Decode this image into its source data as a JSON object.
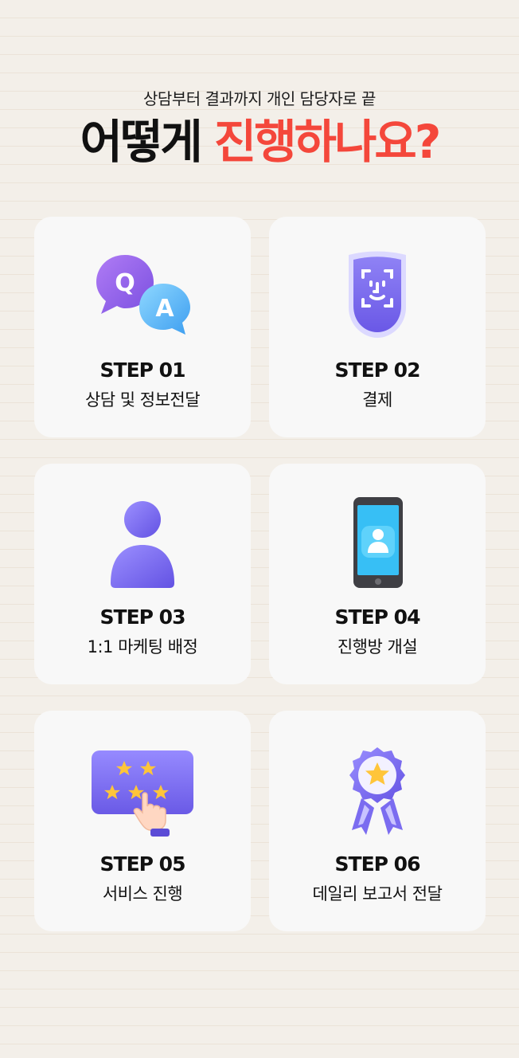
{
  "header": {
    "subtitle": "상담부터 결과까지 개인 담당자로 끝",
    "title_part1": "어떻게",
    "title_part2": "진행하나요?"
  },
  "steps": [
    {
      "step": "STEP 01",
      "desc": "상담 및 정보전달",
      "icon": "qa-bubbles-icon"
    },
    {
      "step": "STEP 02",
      "desc": "결제",
      "icon": "face-id-shield-icon"
    },
    {
      "step": "STEP 03",
      "desc": "1:1 마케팅 배정",
      "icon": "person-icon"
    },
    {
      "step": "STEP 04",
      "desc": "진행방 개설",
      "icon": "smartphone-profile-icon"
    },
    {
      "step": "STEP 05",
      "desc": "서비스 진행",
      "icon": "star-rating-tap-icon"
    },
    {
      "step": "STEP 06",
      "desc": "데일리 보고서 전달",
      "icon": "award-badge-icon"
    }
  ],
  "icon_text": {
    "q": "Q",
    "a": "A"
  },
  "colors": {
    "accent": "#f4473b",
    "title": "#111111",
    "card": "#f8f8f8",
    "purple": "#7b6cf0",
    "star": "#ffc53a"
  }
}
